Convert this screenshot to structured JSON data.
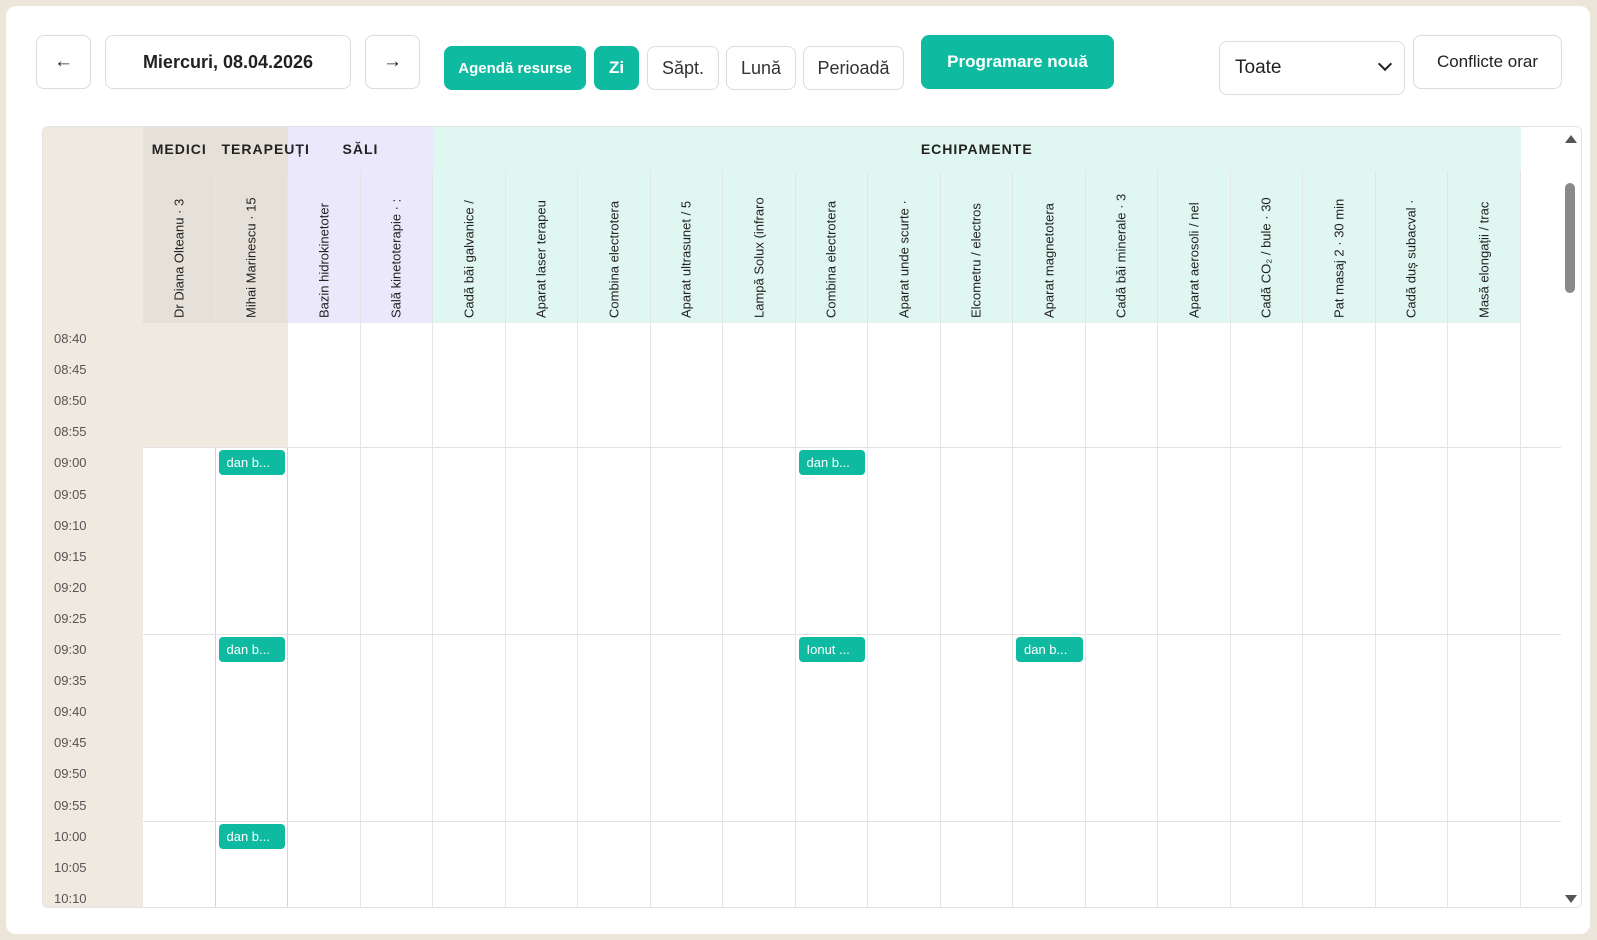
{
  "toolbar": {
    "prev_icon": "←",
    "date_label": "Miercuri, 08.04.2026",
    "next_icon": "→",
    "agenda_label": "Agendă resurse",
    "day_label": "Zi",
    "week_label": "Săpt.",
    "month_label": "Lună",
    "period_label": "Perioadă",
    "new_label": "Programare nouă",
    "filter_value": "Toate",
    "conflicts_label": "Conflicte orar"
  },
  "groups": {
    "medici": "MEDICI",
    "terapeuti": "TERAPEUȚI",
    "sali": "SĂLI",
    "echipamente": "ECHIPAMENTE"
  },
  "columns": [
    "Dr Diana Olteanu · 3",
    "Mihai Marinescu · 15",
    "Bazin hidrokinetoter",
    "Sală kinetoterapie · :",
    "Cadă băi galvanice /",
    "Aparat laser terapeu",
    "Combina electrotera",
    "Aparat ultrasunet / 5",
    "Lampă Solux (infraro",
    "Combina electrotera",
    "Aparat unde scurte ·",
    "Elcometru / electros",
    "Aparat magnetotera",
    "Cadă băi minerale · 3",
    "Aparat aerosoli / nel",
    "Cadă CO₂ / bule · 30",
    "Pat masaj 2 · 30 min",
    "Cadă duș subacval ·",
    "Masă elongații / trac"
  ],
  "times": [
    "08:40",
    "08:45",
    "08:50",
    "08:55",
    "09:00",
    "09:05",
    "09:10",
    "09:15",
    "09:20",
    "09:25",
    "09:30",
    "09:35",
    "09:40",
    "09:45",
    "09:50",
    "09:55",
    "10:00",
    "10:05",
    "10:10"
  ],
  "events": [
    {
      "label": "dan b...",
      "time": "09:00",
      "column": "Mihai Marinescu · 15"
    },
    {
      "label": "dan b...",
      "time": "09:00",
      "column": "Combina electrotera"
    },
    {
      "label": "dan b...",
      "time": "09:30",
      "column": "Mihai Marinescu · 15"
    },
    {
      "label": "Ionut ...",
      "time": "09:30",
      "column": "Combina electrotera"
    },
    {
      "label": "dan b...",
      "time": "09:30",
      "column": "Aparat magnetotera"
    },
    {
      "label": "dan b...",
      "time": "10:00",
      "column": "Mihai Marinescu · 15"
    }
  ],
  "colors": {
    "accent": "#0fbba0",
    "medici_bg": "#e6e1d8",
    "sali_bg": "#ebe8fb",
    "echipamente_bg": "#e0f6f1",
    "time_bg": "#efe9df"
  },
  "icons": {
    "prev": "arrow-left-icon",
    "next": "arrow-right-icon",
    "select": "chevron-down-icon"
  }
}
